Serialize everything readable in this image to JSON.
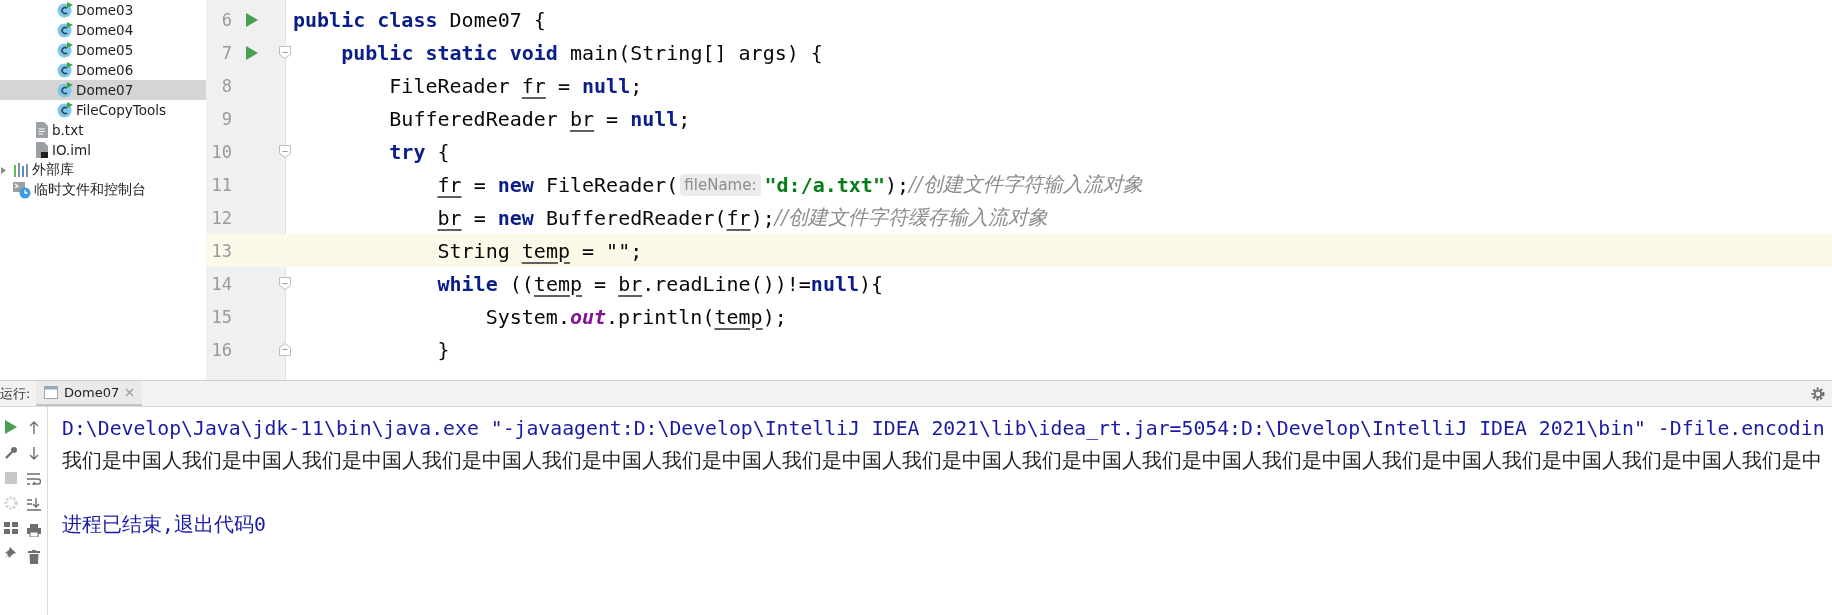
{
  "project_tree": [
    {
      "children": [
        {
          "children": [
            {
              "kind": "class",
              "label": "Dome03",
              "selected": false
            },
            {
              "kind": "class",
              "label": "Dome04",
              "selected": false
            },
            {
              "kind": "class",
              "label": "Dome05",
              "selected": false
            },
            {
              "kind": "class",
              "label": "Dome06",
              "selected": false
            },
            {
              "kind": "class",
              "label": "Dome07",
              "selected": true
            },
            {
              "kind": "class",
              "label": "FileCopyTools",
              "selected": false
            }
          ]
        },
        {
          "kind": "text_file",
          "label": "b.txt",
          "selected": false
        },
        {
          "kind": "module_file",
          "label": "IO.iml",
          "selected": false
        }
      ]
    },
    {
      "kind": "library",
      "label": "外部库",
      "selected": false,
      "expanded": false
    },
    {
      "kind": "scratches",
      "label": "临时文件和控制台",
      "selected": false
    }
  ],
  "editor": {
    "lines": [
      {
        "number": "6",
        "runnable": true,
        "current": false,
        "fold_start": false,
        "fold_end": false,
        "tokens": [
          {
            "kind": "keyword",
            "text": "public class"
          },
          {
            "kind": "plain",
            "text": " Dome07 {"
          }
        ]
      },
      {
        "number": "7",
        "runnable": true,
        "current": false,
        "fold_start": true,
        "fold_end": false,
        "tokens": [
          {
            "kind": "keyword",
            "text": "    public static void"
          },
          {
            "kind": "plain",
            "text": " main(String[] args) {"
          }
        ]
      },
      {
        "number": "8",
        "runnable": false,
        "current": false,
        "fold_start": false,
        "fold_end": false,
        "tokens": [
          {
            "kind": "plain",
            "text": "        FileReader "
          },
          {
            "kind": "variable",
            "text": "fr"
          },
          {
            "kind": "plain",
            "text": " = "
          },
          {
            "kind": "keyword",
            "text": "null"
          },
          {
            "kind": "plain",
            "text": ";"
          }
        ]
      },
      {
        "number": "9",
        "runnable": false,
        "current": false,
        "fold_start": false,
        "fold_end": false,
        "tokens": [
          {
            "kind": "plain",
            "text": "        BufferedReader "
          },
          {
            "kind": "variable",
            "text": "br"
          },
          {
            "kind": "plain",
            "text": " = "
          },
          {
            "kind": "keyword",
            "text": "null"
          },
          {
            "kind": "plain",
            "text": ";"
          }
        ]
      },
      {
        "number": "10",
        "runnable": false,
        "current": false,
        "fold_start": true,
        "fold_end": false,
        "tokens": [
          {
            "kind": "keyword",
            "text": "        try"
          },
          {
            "kind": "plain",
            "text": " {"
          }
        ]
      },
      {
        "number": "11",
        "runnable": false,
        "current": false,
        "fold_start": false,
        "fold_end": false,
        "tokens": [
          {
            "kind": "variable",
            "text": "            fr"
          },
          {
            "kind": "plain",
            "text": " = "
          },
          {
            "kind": "keyword",
            "text": "new"
          },
          {
            "kind": "plain",
            "text": " FileReader("
          },
          {
            "kind": "hint",
            "text": "fileName:"
          },
          {
            "kind": "string",
            "text": "\"d:/a.txt\""
          },
          {
            "kind": "plain",
            "text": ");"
          },
          {
            "kind": "comment",
            "text": "//创建文件字符输入流对象"
          }
        ]
      },
      {
        "number": "12",
        "runnable": false,
        "current": false,
        "fold_start": false,
        "fold_end": false,
        "tokens": [
          {
            "kind": "variable",
            "text": "            br"
          },
          {
            "kind": "plain",
            "text": " = "
          },
          {
            "kind": "keyword",
            "text": "new"
          },
          {
            "kind": "plain",
            "text": " BufferedReader("
          },
          {
            "kind": "variable",
            "text": "fr"
          },
          {
            "kind": "plain",
            "text": ");"
          },
          {
            "kind": "comment",
            "text": "//创建文件字符缓存输入流对象"
          }
        ]
      },
      {
        "number": "13",
        "runnable": false,
        "current": true,
        "fold_start": false,
        "fold_end": false,
        "tokens": [
          {
            "kind": "plain",
            "text": "            String "
          },
          {
            "kind": "variable",
            "text": "temp"
          },
          {
            "kind": "plain",
            "text": " = \"\";"
          }
        ]
      },
      {
        "number": "14",
        "runnable": false,
        "current": false,
        "fold_start": true,
        "fold_end": false,
        "tokens": [
          {
            "kind": "keyword",
            "text": "            while"
          },
          {
            "kind": "plain",
            "text": " (("
          },
          {
            "kind": "variable",
            "text": "temp"
          },
          {
            "kind": "plain",
            "text": " = "
          },
          {
            "kind": "variable",
            "text": "br"
          },
          {
            "kind": "plain",
            "text": ".readLine())!="
          },
          {
            "kind": "keyword",
            "text": "null"
          },
          {
            "kind": "plain",
            "text": "){"
          }
        ]
      },
      {
        "number": "15",
        "runnable": false,
        "current": false,
        "fold_start": false,
        "fold_end": false,
        "tokens": [
          {
            "kind": "plain",
            "text": "                System."
          },
          {
            "kind": "field",
            "text": "out"
          },
          {
            "kind": "plain",
            "text": ".println("
          },
          {
            "kind": "variable",
            "text": "temp"
          },
          {
            "kind": "plain",
            "text": ");"
          }
        ]
      },
      {
        "number": "16",
        "runnable": false,
        "current": false,
        "fold_start": false,
        "fold_end": true,
        "tokens": [
          {
            "kind": "plain",
            "text": "            }"
          }
        ]
      }
    ]
  },
  "run_panel": {
    "label": "运行:",
    "tabs": [
      {
        "label": "Dome07",
        "selected": true
      }
    ],
    "console": [
      {
        "kind": "command",
        "text": "D:\\Develop\\Java\\jdk-11\\bin\\java.exe \"-javaagent:D:\\Develop\\IntelliJ IDEA 2021\\lib\\idea_rt.jar=5054:D:\\Develop\\IntelliJ IDEA 2021\\bin\" -Dfile.encodin"
      },
      {
        "kind": "output",
        "text": "我们是中国人我们是中国人我们是中国人我们是中国人我们是中国人我们是中国人我们是中国人我们是中国人我们是中国人我们是中国人我们是中国人我们是中国人我们是中国人我们是中国人我们是中"
      },
      {
        "kind": "blank"
      },
      {
        "kind": "exit",
        "text": "进程已结束,退出代码0"
      }
    ]
  }
}
